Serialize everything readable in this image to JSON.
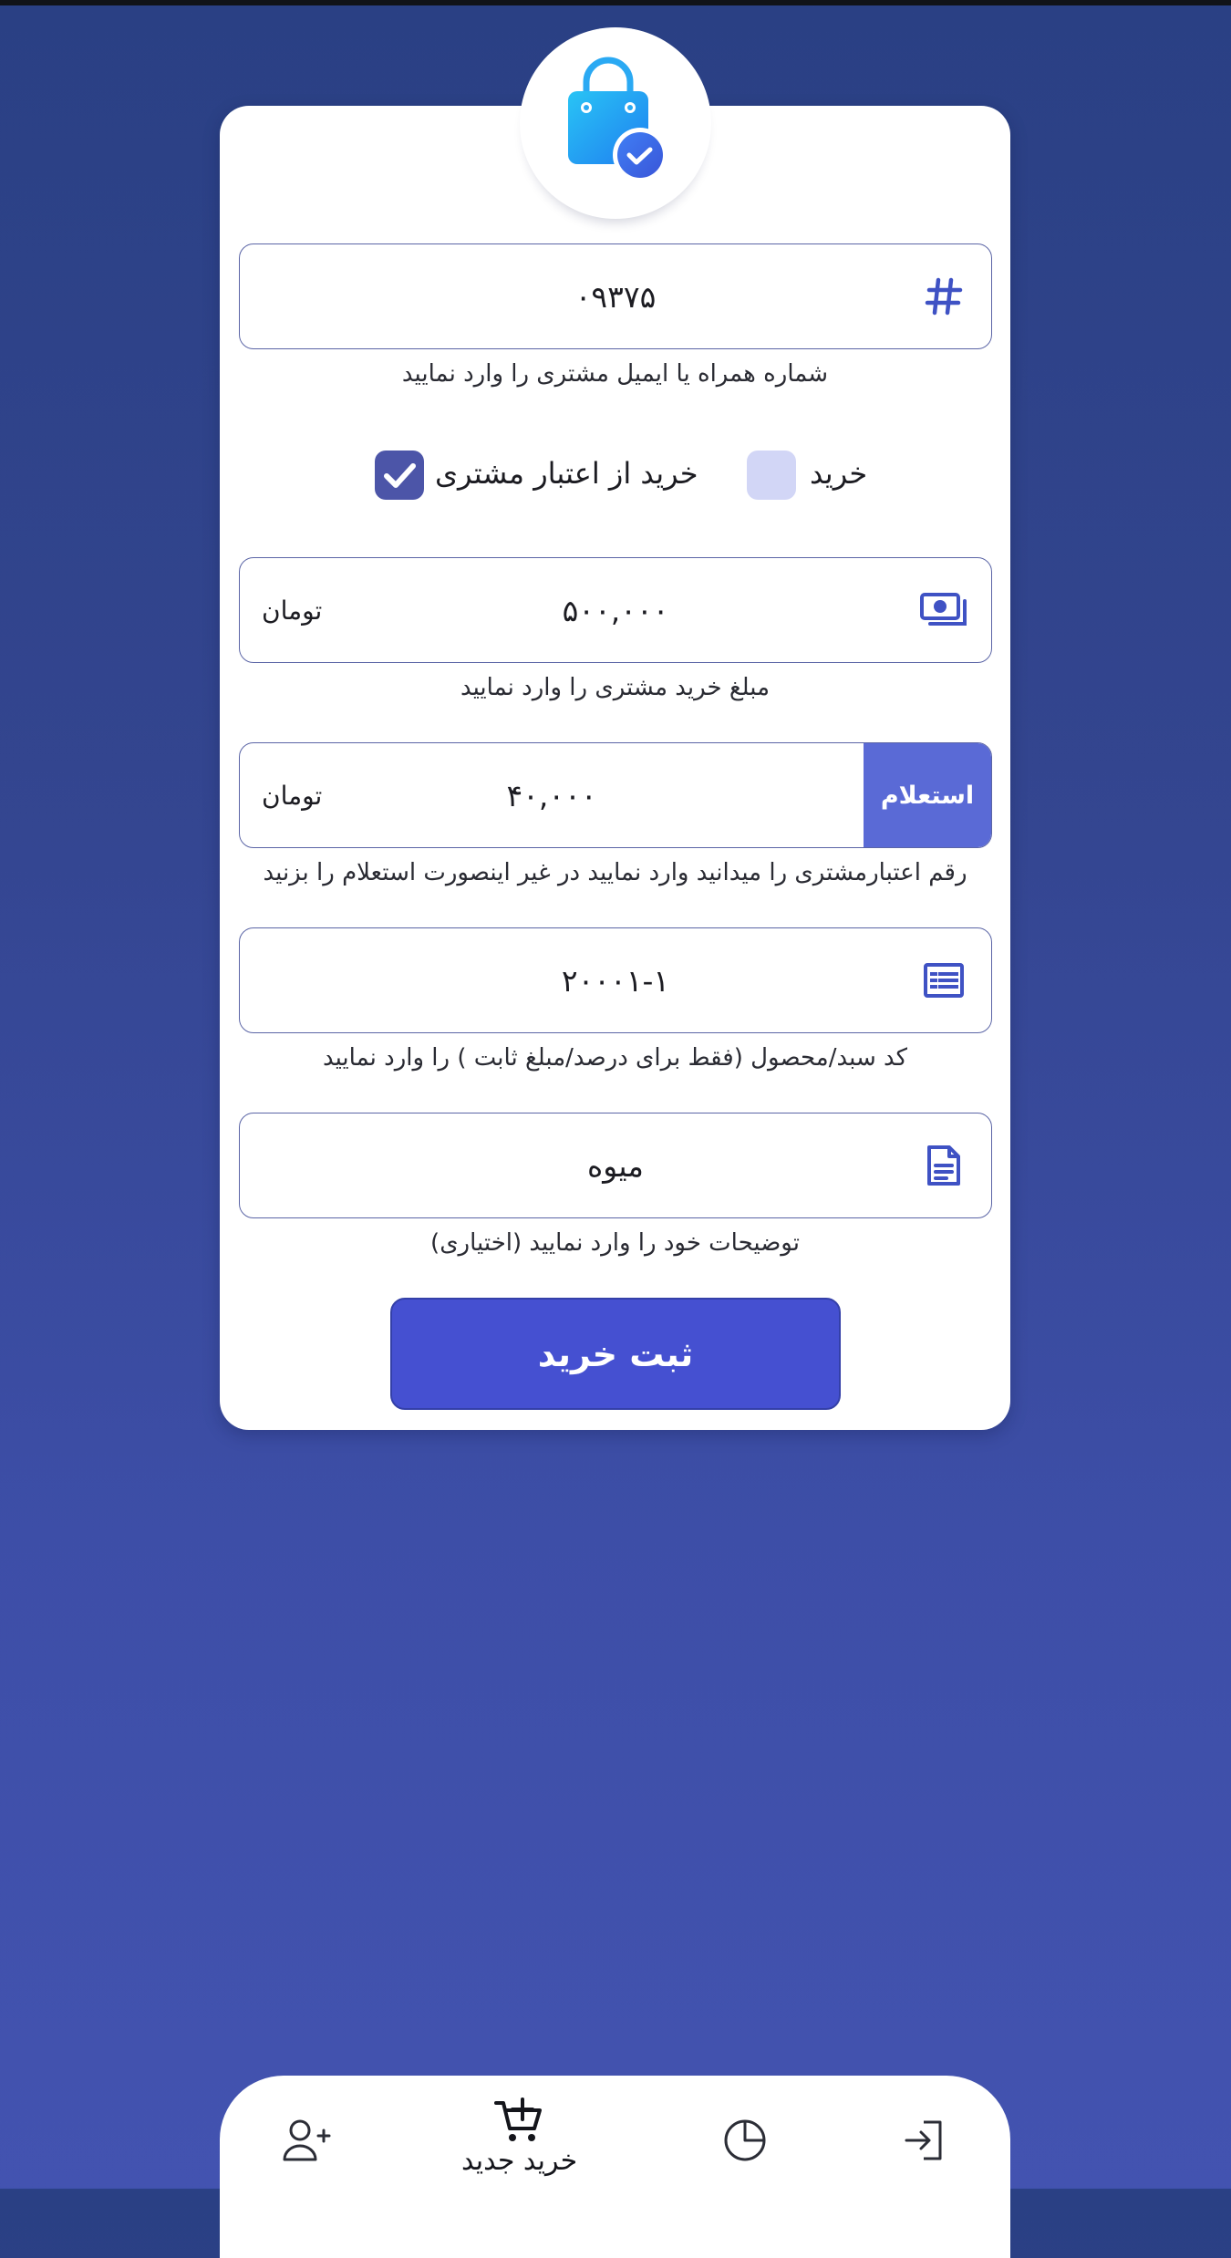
{
  "form": {
    "contact": {
      "value": "۰۹۳۷۵",
      "helper": "شماره همراه یا ایمیل مشتری را وارد نمایید"
    },
    "options": {
      "purchase_label": "خرید",
      "purchase_checked": false,
      "credit_purchase_label": "خرید از اعتبار مشتری",
      "credit_purchase_checked": true
    },
    "amount": {
      "value": "۵۰۰,۰۰۰",
      "unit": "تومان",
      "helper": "مبلغ خرید مشتری را وارد نمایید"
    },
    "credit": {
      "value": "۴۰,۰۰۰",
      "unit": "تومان",
      "inquiry_label": "استعلام",
      "helper": "رقم اعتبارمشتری را میدانید وارد نمایید در غیر اینصورت استعلام را بزنید"
    },
    "product_code": {
      "value": "۲۰۰۰۱-۱",
      "helper": "کد سبد/محصول (فقط برای درصد/مبلغ ثابت ) را وارد نمایید"
    },
    "description": {
      "value": "میوه",
      "helper": "توضیحات خود را وارد نمایید (اختیاری)"
    },
    "submit_label": "ثبت خرید"
  },
  "bottom_nav": {
    "items": [
      {
        "icon": "add-user-icon",
        "label": ""
      },
      {
        "icon": "cart-add-icon",
        "label": "خرید جدید",
        "active": true
      },
      {
        "icon": "pie-chart-icon",
        "label": ""
      },
      {
        "icon": "logout-icon",
        "label": ""
      }
    ]
  },
  "colors": {
    "background_top": "#2a4084",
    "background_bottom": "#4353b0",
    "accent": "#4550d1",
    "inquiry": "#5a6ad6",
    "icon": "#3f52c4",
    "checkbox_checked": "#4c55a8",
    "checkbox_unchecked": "#d2d6f6"
  }
}
